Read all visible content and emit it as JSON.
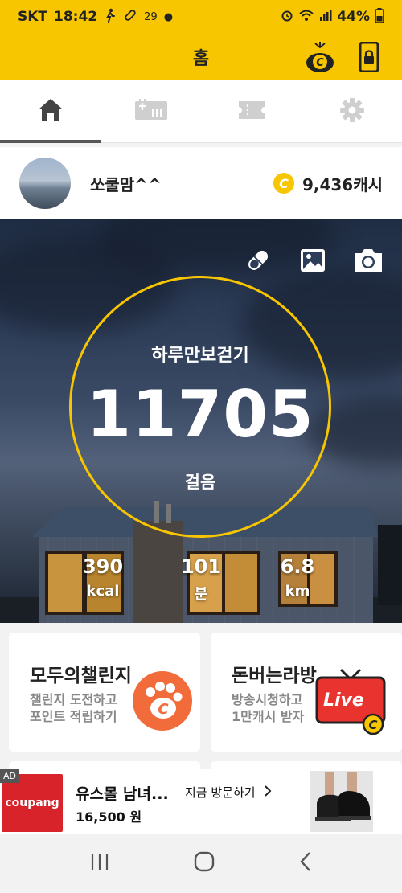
{
  "status_bar": {
    "carrier": "SKT",
    "time": "18:42",
    "notification_count": "29",
    "battery": "44%"
  },
  "app_bar": {
    "title": "홈"
  },
  "tabs": [
    {
      "icon": "home-icon",
      "active": true
    },
    {
      "icon": "calculator-icon",
      "active": false
    },
    {
      "icon": "ticket-icon",
      "active": false
    },
    {
      "icon": "gear-icon",
      "active": false
    }
  ],
  "profile": {
    "nickname": "쏘쿨맘^^",
    "cash_symbol": "C",
    "cash": "9,436캐시"
  },
  "walker": {
    "label": "하루만보걷기",
    "steps": "11705",
    "steps_unit": "걸음",
    "kcal_value": "390",
    "kcal_unit": "kcal",
    "minutes_value": "101",
    "minutes_unit": "분",
    "distance_value": "6.8",
    "distance_unit": "km",
    "step_goal_progress": 1.0
  },
  "cards": [
    {
      "title": "모두의챌린지",
      "desc_line1": "챌린지 도전하고",
      "desc_line2": "포인트 적립하기"
    },
    {
      "title": "돈버는라방",
      "desc_line1": "방송시청하고",
      "desc_line2": "1만캐시 받자",
      "badge": "Live"
    }
  ],
  "ad": {
    "tag": "AD",
    "logo_text": "coupang",
    "title": "유스몰 남녀...",
    "price": "16,500 원",
    "visit_label": "지금 방문하기"
  },
  "colors": {
    "brand_yellow": "#f7c600",
    "live_red": "#e8332f",
    "challenge_orange": "#f26b3a"
  }
}
